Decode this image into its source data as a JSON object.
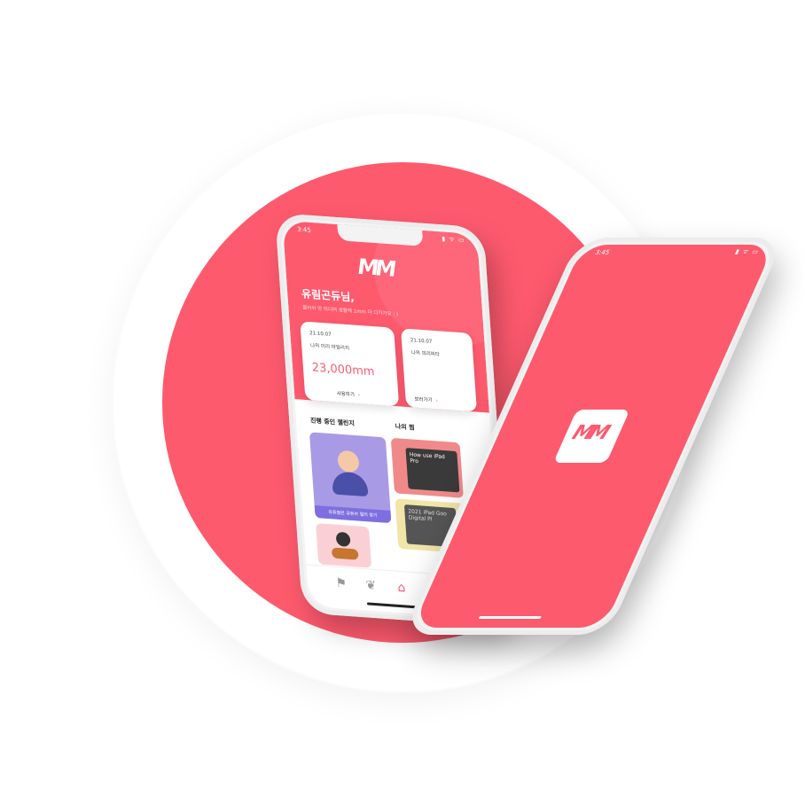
{
  "colors": {
    "accent": "#fe5a6e",
    "background": "#ffffff"
  },
  "status": {
    "time": "3:45",
    "icons": "signal-wifi-battery"
  },
  "app": {
    "logo_text": "MM"
  },
  "home": {
    "greeting": "유림곤듀님,",
    "subtext": "플러쉬 안 미디어 생활에 1mm 더 다가가요 : )",
    "cards": [
      {
        "date": "21.10.07",
        "title": "나의 미리 마일리지",
        "amount": "23,000mm",
        "action": "사용하기"
      },
      {
        "date": "21.10.07",
        "title": "나의 피리피타",
        "action": "보러가기"
      }
    ],
    "sections": {
      "challenges": "진행 중인 챌린지",
      "my_picks": "나의 찜"
    },
    "tiles": {
      "yoga_caption": "유튜블런 유튜브 멀리 찾기",
      "ipad_text": "How use iPad Pro",
      "book_text": "2021 iPad Goo Digital Pl"
    }
  }
}
